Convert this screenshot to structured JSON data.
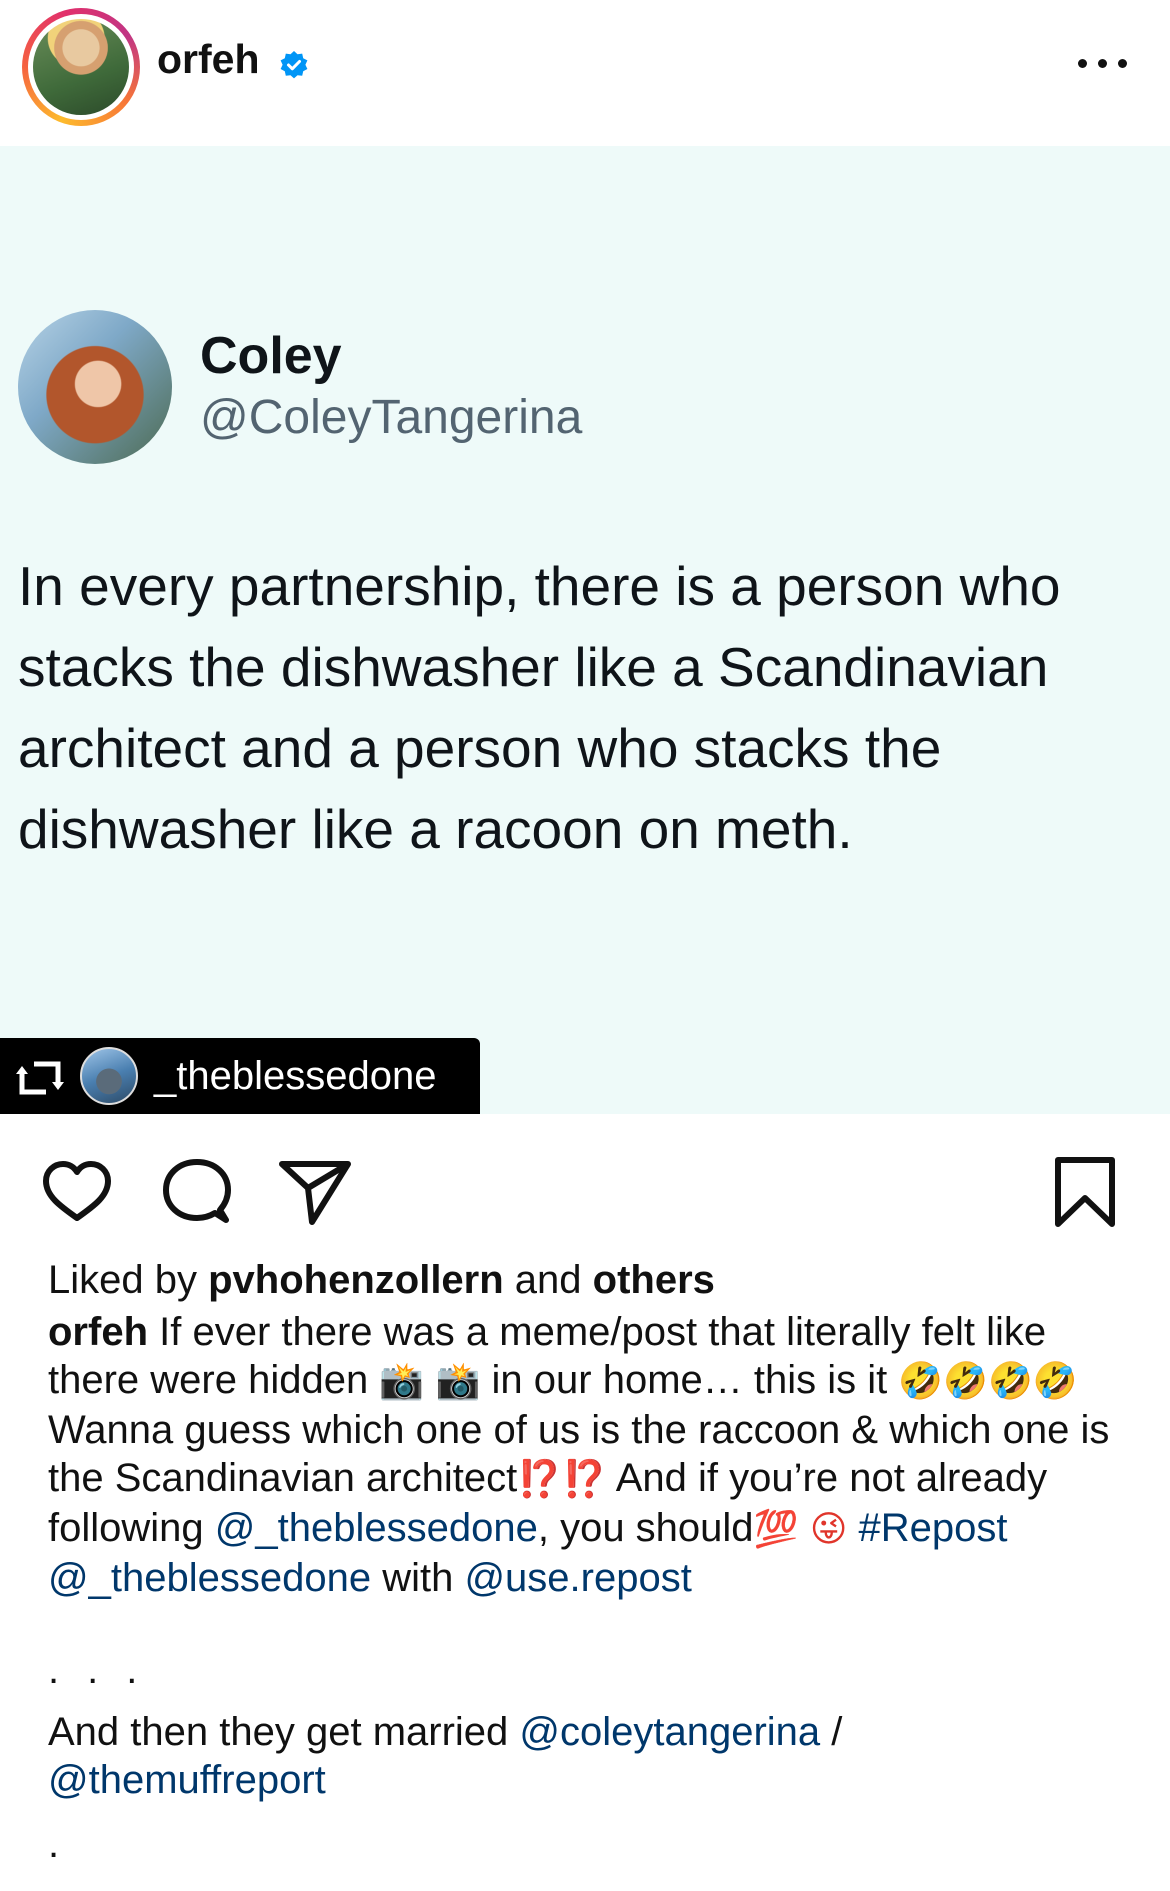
{
  "header": {
    "username": "orfeh",
    "more_icon": "more-horizontal-icon",
    "verified_icon": "verified-badge-icon",
    "brand_blue": "#0095f6"
  },
  "tweet": {
    "name": "Coley",
    "handle": "@ColeyTangerina",
    "text": "In every partnership, there is a person who stacks the dishwasher like a Scandinavian architect and a person who stacks the dishwasher like a racoon on meth."
  },
  "repost_tag": {
    "username": "_theblessedone",
    "icon": "repost-icon"
  },
  "actions": {
    "like_icon": "heart-icon",
    "comment_icon": "comment-icon",
    "share_icon": "send-icon",
    "save_icon": "bookmark-icon"
  },
  "likes": {
    "prefix": "Liked by ",
    "user": "pvhohenzollern",
    "middle": " and ",
    "others": "others"
  },
  "caption": {
    "author": "orfeh",
    "t1": " If ever there was a meme/post that literally felt like there were hidden ",
    "e1": "📸 📸",
    "t2": " in our home… this is it ",
    "e2": "🤣🤣🤣🤣",
    "t3": " Wanna guess which one of us is the raccoon & which one is the Scandinavian architect",
    "e3": "⁉️⁉️",
    "t4": " And if you’re not already following ",
    "mention1": "@_theblessedone",
    "t5": ", you should",
    "e4": "💯 😜",
    "t6": " ",
    "hashtag": "#Repost",
    "t7": " ",
    "mention2": "@_theblessedone",
    "t8": " with ",
    "mention3": "@use.repost",
    "dots": "...",
    "line2_prefix": "And then they get married ",
    "mention4": "@coleytangerina",
    "slash": " / ",
    "mention5": "@themuffreport",
    "final_dot": "."
  }
}
